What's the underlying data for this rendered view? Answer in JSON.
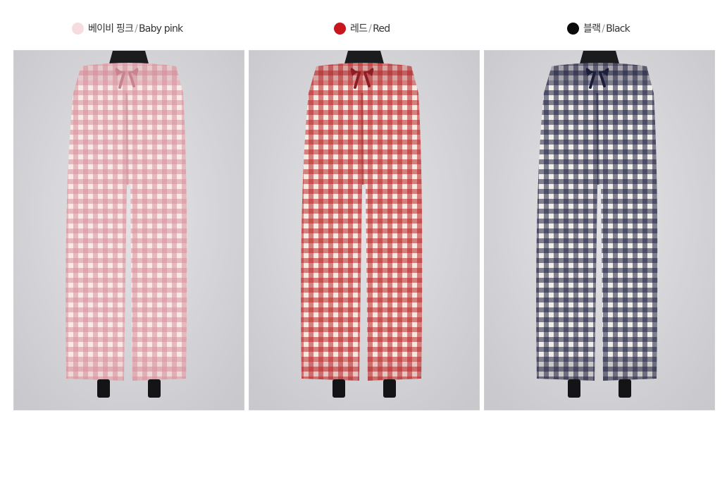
{
  "swatches": [
    {
      "ko": "베이비 핑크",
      "slash": "/",
      "en": "Baby pink",
      "color": "#f7dcdf"
    },
    {
      "ko": "레드",
      "slash": "/",
      "en": "Red",
      "color": "#c8161d"
    },
    {
      "ko": "블랙",
      "slash": "/",
      "en": "Black",
      "color": "#0a0a0a"
    }
  ],
  "products": [
    {
      "name": "pink-gingham-pants",
      "check": "#d9919e",
      "base": "#f5ebe6",
      "tie": "#c9828f",
      "shade": "#c78a95"
    },
    {
      "name": "red-gingham-pants",
      "check": "#b8292e",
      "base": "#f2ebe2",
      "tie": "#8e1e25",
      "shade": "#9e2429"
    },
    {
      "name": "navy-gingham-pants",
      "check": "#232544",
      "base": "#f0ede6",
      "tie": "#1b1d3a",
      "shade": "#1f2038"
    }
  ]
}
